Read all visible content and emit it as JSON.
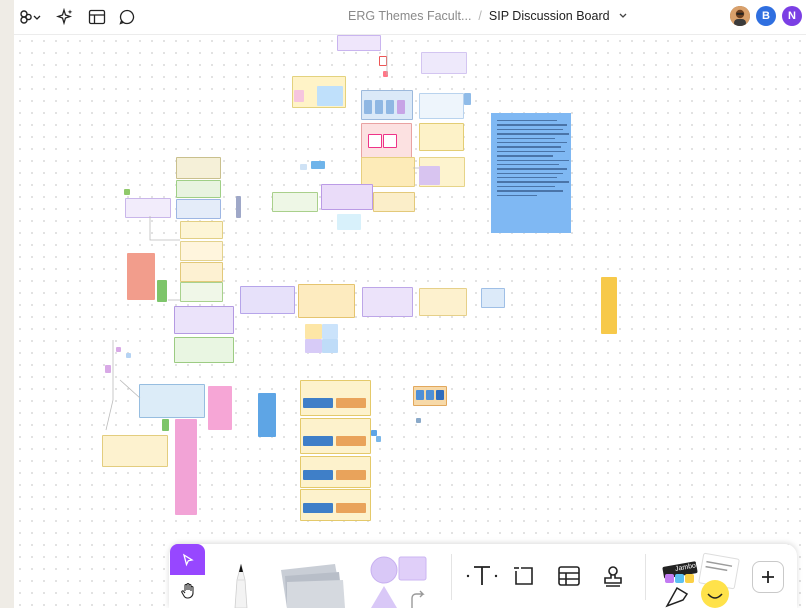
{
  "app": {
    "breadcrumb": {
      "team": "ERG Themes Facult...",
      "separator": "/",
      "board": "SIP Discussion Board"
    },
    "avatars": [
      {
        "initial": "",
        "color": "#8a5a2b"
      },
      {
        "initial": "B",
        "color": "#2f6fe0"
      },
      {
        "initial": "N",
        "color": "#7b3fe4"
      }
    ],
    "accent": "#9747ff"
  },
  "toolbar": {
    "tools": [
      {
        "name": "move-tool",
        "active": true
      },
      {
        "name": "hand-tool",
        "active": false
      },
      {
        "name": "marker-tool",
        "active": false
      },
      {
        "name": "sticky-note-tool",
        "active": false
      },
      {
        "name": "shape-tool",
        "active": false
      },
      {
        "name": "text-tool",
        "active": false
      },
      {
        "name": "section-tool",
        "active": false
      },
      {
        "name": "table-tool",
        "active": false
      },
      {
        "name": "stamp-tool",
        "active": false
      },
      {
        "name": "widgets-tool",
        "active": false
      },
      {
        "name": "more-tool",
        "active": false
      }
    ],
    "widgets_label": "Jambot"
  }
}
